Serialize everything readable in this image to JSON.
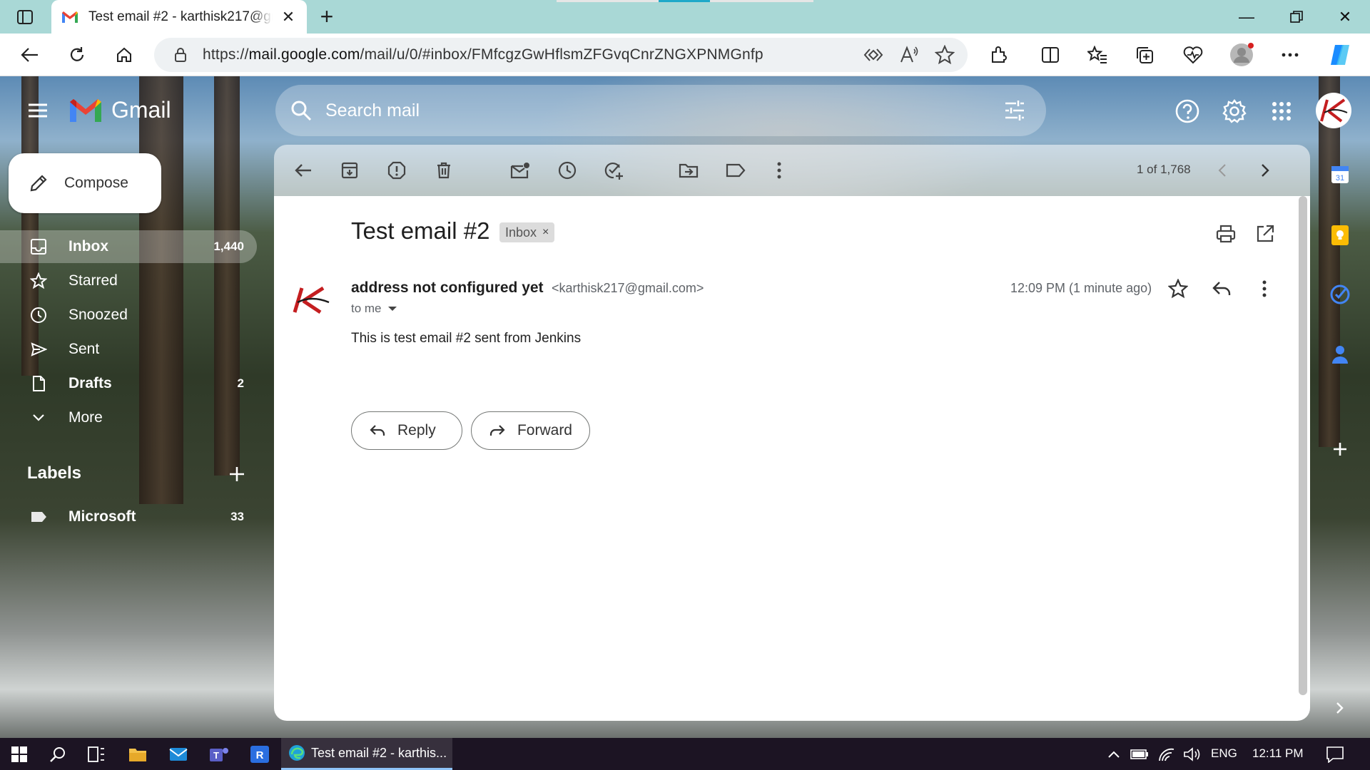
{
  "browser": {
    "tab_title": "Test email #2 - karthisk217@gmail.com",
    "url_prefix": "https://",
    "url_domain": "mail.google.com",
    "url_path": "/mail/u/0/#inbox/FMfcgzGwHflsmZFGvqCnrZNGXPNMGnfp"
  },
  "gmail": {
    "app_name": "Gmail",
    "search_placeholder": "Search mail",
    "compose_label": "Compose",
    "nav": [
      {
        "label": "Inbox",
        "count": "1,440"
      },
      {
        "label": "Starred",
        "count": ""
      },
      {
        "label": "Snoozed",
        "count": ""
      },
      {
        "label": "Sent",
        "count": ""
      },
      {
        "label": "Drafts",
        "count": "2"
      },
      {
        "label": "More",
        "count": ""
      }
    ],
    "labels_header": "Labels",
    "labels": [
      {
        "label": "Microsoft",
        "count": "33"
      }
    ],
    "pager": "1 of 1,768"
  },
  "email": {
    "subject": "Test email #2",
    "chip": "Inbox",
    "chip_close": "×",
    "sender_name": "address not configured yet",
    "sender_email": "<karthisk217@gmail.com>",
    "to": "to me",
    "time": "12:09 PM (1 minute ago)",
    "body": "This is test email #2 sent from Jenkins",
    "reply_label": "Reply",
    "forward_label": "Forward"
  },
  "taskbar": {
    "active_window": "Test email #2 - karthis...",
    "language": "ENG",
    "clock": "12:11 PM"
  },
  "colors": {
    "gmail_red": "#ea4335",
    "tab_bar": "#a9d8d6",
    "taskbar": "#1c1423"
  }
}
